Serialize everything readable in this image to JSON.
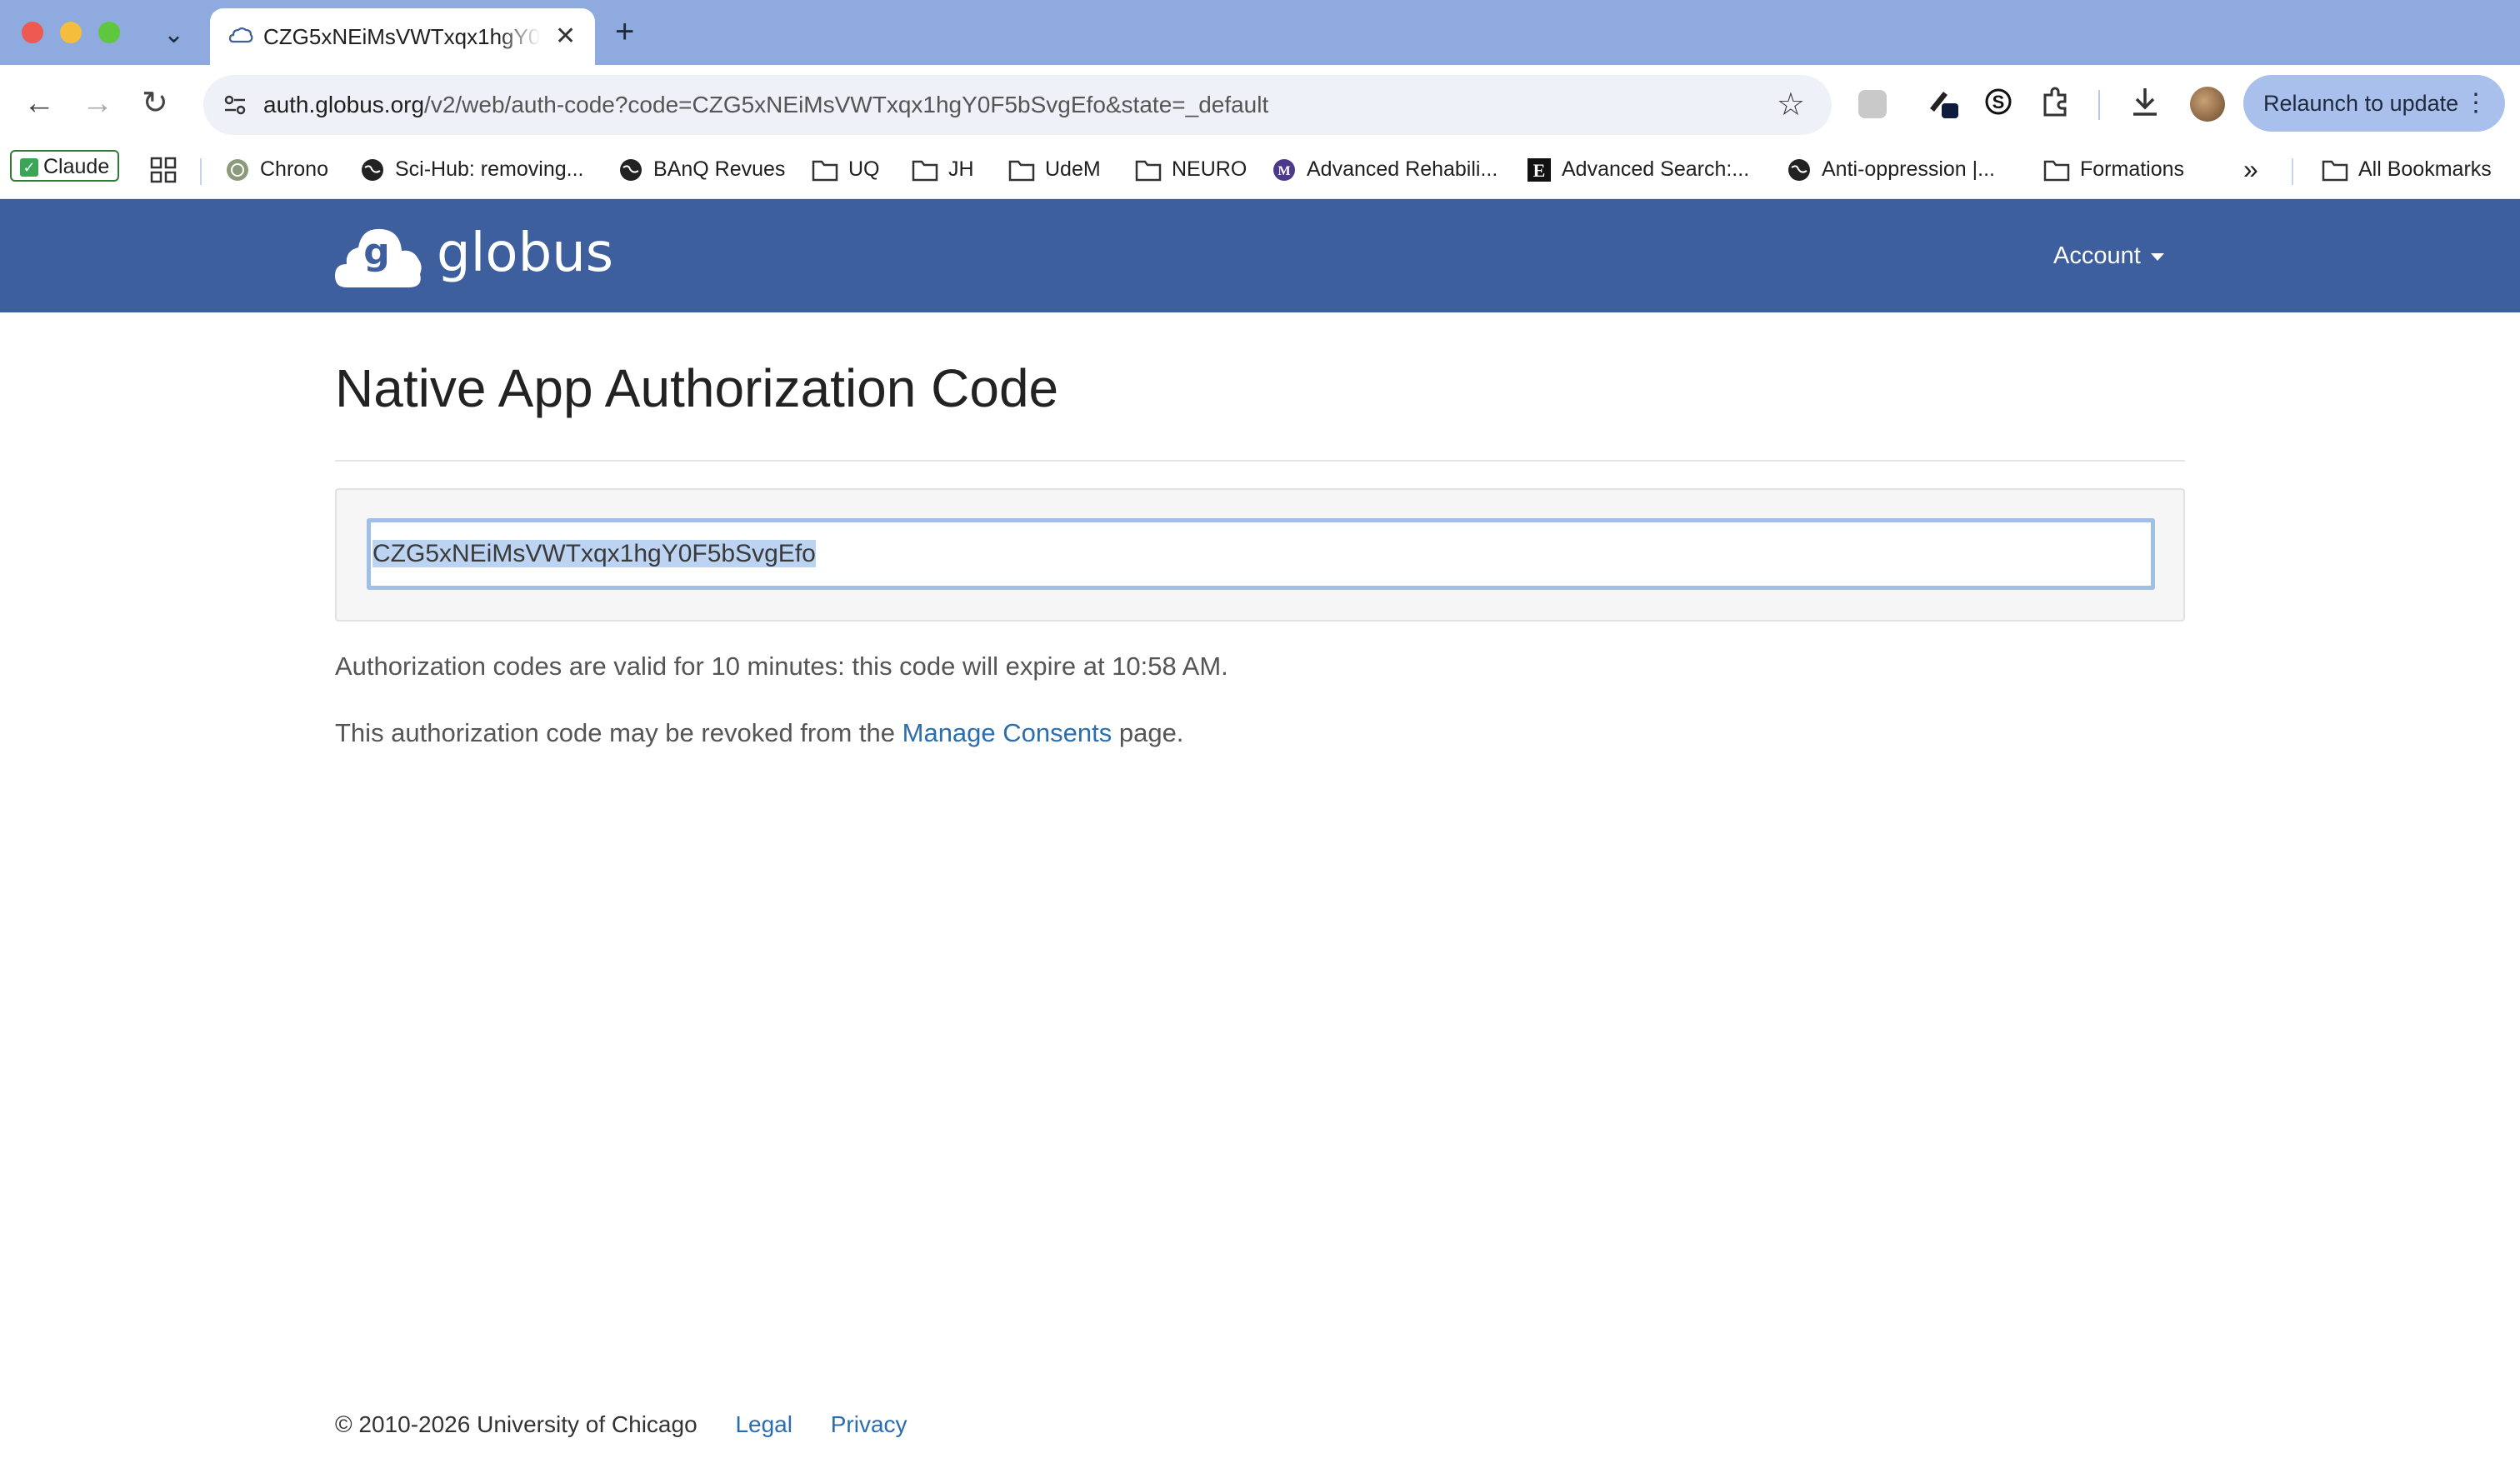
{
  "browser": {
    "tab": {
      "title": "CZG5xNEiMsVWTxqx1hgY0F5bSvgEfo"
    },
    "url_host": "auth.globus.org",
    "url_path": "/v2/web/auth-code?code=CZG5xNEiMsVWTxqx1hgY0F5bSvgEfo&state=_default",
    "relaunch_label": "Relaunch to update",
    "bookmarks": [
      {
        "label": "Claude",
        "icon": "claude-icon"
      },
      {
        "label": "Chrono",
        "icon": "chrono-icon"
      },
      {
        "label": "Sci-Hub: removing...",
        "icon": "globe-icon"
      },
      {
        "label": "BAnQ Revues",
        "icon": "globe-icon"
      },
      {
        "label": "UQ",
        "icon": "folder-icon"
      },
      {
        "label": "JH",
        "icon": "folder-icon"
      },
      {
        "label": "UdeM",
        "icon": "folder-icon"
      },
      {
        "label": "NEURO",
        "icon": "folder-icon"
      },
      {
        "label": "Advanced Rehabili...",
        "icon": "m-icon"
      },
      {
        "label": "Advanced Search:...",
        "icon": "e-icon"
      },
      {
        "label": "Anti-oppression |...",
        "icon": "globe-icon"
      },
      {
        "label": "Formations",
        "icon": "folder-icon"
      }
    ],
    "overflow_label": "»",
    "all_bookmarks_label": "All Bookmarks"
  },
  "header": {
    "logo_text": "globus",
    "account_label": "Account"
  },
  "main": {
    "title": "Native App Authorization Code",
    "auth_code": "CZG5xNEiMsVWTxqx1hgY0F5bSvgEfo",
    "validity_text": "Authorization codes are valid for 10 minutes: this code will expire at 10:58 AM.",
    "revoke_prefix": "This authorization code may be revoked from the ",
    "revoke_link": "Manage Consents",
    "revoke_suffix": " page."
  },
  "footer": {
    "copyright": "© 2010-2026 University of Chicago",
    "legal": "Legal",
    "privacy": "Privacy"
  },
  "colors": {
    "header_bg": "#3d5f9d",
    "link": "#2a6db0",
    "titlebar": "#8eaadf"
  }
}
